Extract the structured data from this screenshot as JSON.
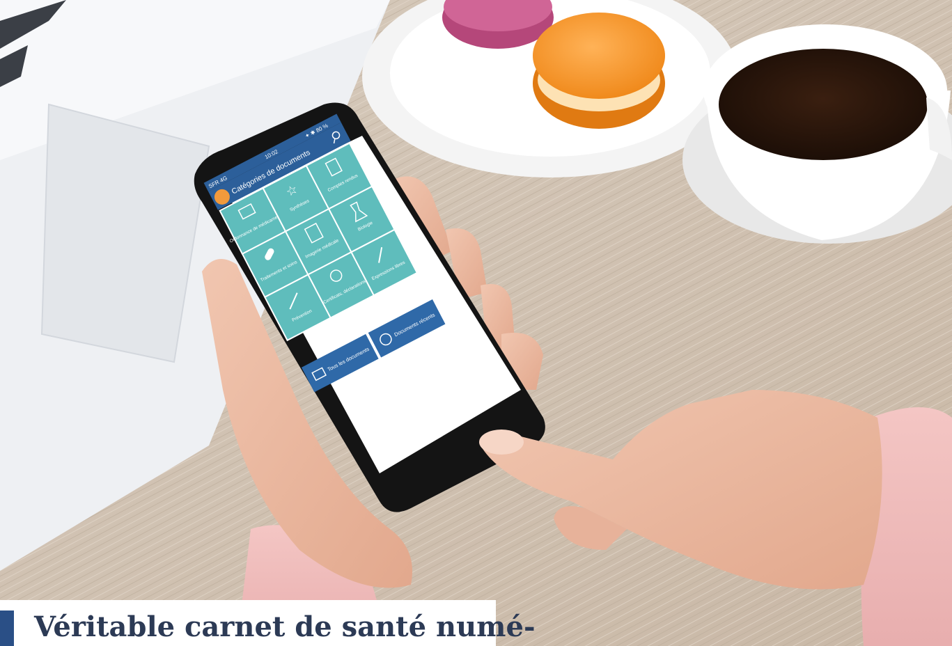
{
  "photo": {
    "subject": "Hands holding a smartphone showing a health records app, on a wooden table with a laptop, macarons and a cup of coffee"
  },
  "phone_screen": {
    "status_time": "10:02",
    "status_battery": "✦ ✱ 80 %",
    "status_carrier": "SFR 4G",
    "header_title": "Catégories de documents",
    "tiles": [
      "Ordonnance de médicaments",
      "Synthèses",
      "Comptes rendus",
      "Traitements et soins",
      "Imagerie médicale",
      "Biologie",
      "Prévention",
      "Certificats, déclarations",
      "Expressions libres"
    ],
    "bottom_buttons": [
      "Tous les documents",
      "Documents récents"
    ],
    "colors": {
      "tile": "#5fbdbc",
      "tile_border": "#ffffff",
      "header": "#2c5f9a",
      "button": "#2f69a8"
    }
  },
  "caption": {
    "text": "Véritable carnet de santé numé-"
  }
}
